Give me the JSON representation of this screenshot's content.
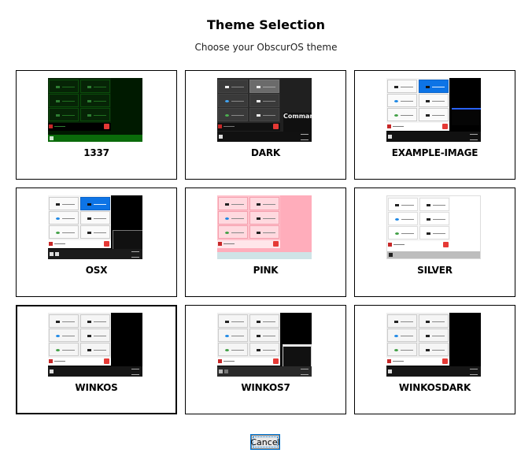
{
  "header": {
    "title": "Theme Selection",
    "subtitle": "Choose your ObscurOS theme"
  },
  "themes": [
    {
      "name": "1337",
      "selected": false
    },
    {
      "name": "DARK",
      "selected": false
    },
    {
      "name": "EXAMPLE-IMAGE",
      "selected": false
    },
    {
      "name": "OSX",
      "selected": false
    },
    {
      "name": "PINK",
      "selected": false
    },
    {
      "name": "SILVER",
      "selected": false
    },
    {
      "name": "WINKOS",
      "selected": true
    },
    {
      "name": "WINKOS7",
      "selected": false
    },
    {
      "name": "WINKOSDARK",
      "selected": false
    }
  ],
  "thumb_text": {
    "dark_command": "Comman"
  },
  "footer": {
    "cancel_label": "Cancel"
  }
}
